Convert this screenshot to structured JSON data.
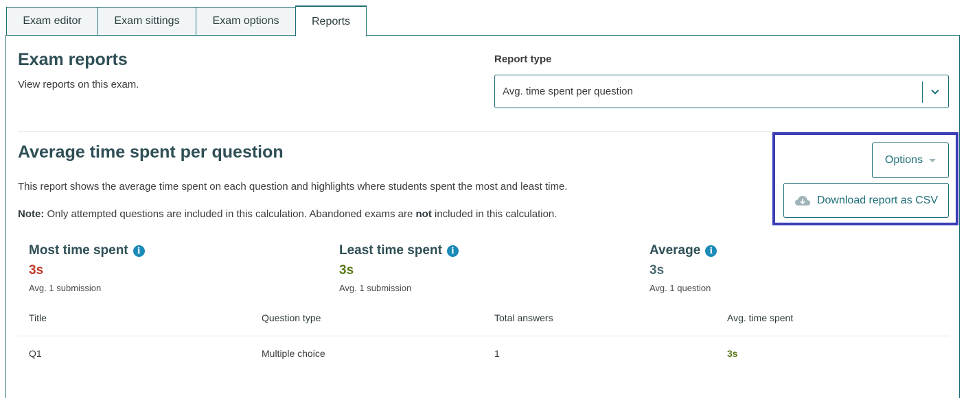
{
  "tabs": [
    {
      "label": "Exam editor"
    },
    {
      "label": "Exam sittings"
    },
    {
      "label": "Exam options"
    },
    {
      "label": "Reports"
    }
  ],
  "header": {
    "title": "Exam reports",
    "subtitle": "View reports on this exam."
  },
  "report_type": {
    "label": "Report type",
    "selected": "Avg. time spent per question"
  },
  "report": {
    "title": "Average time spent per question",
    "description": "This report shows the average time spent on each question and highlights where students spent the most and least time.",
    "note_label": "Note:",
    "note_part1": " Only attempted questions are included in this calculation. Abandoned exams are ",
    "note_bold": "not",
    "note_part2": " included in this calculation."
  },
  "actions": {
    "options_label": "Options",
    "download_label": "Download report as CSV"
  },
  "stats": {
    "most": {
      "title": "Most time spent",
      "value": "3s",
      "sub": "Avg. 1 submission",
      "color": "#c0392b"
    },
    "least": {
      "title": "Least time spent",
      "value": "3s",
      "sub": "Avg. 1 submission",
      "color": "#5a7a1a"
    },
    "average": {
      "title": "Average",
      "value": "3s",
      "sub": "Avg. 1 question",
      "color": "#4a6b72"
    }
  },
  "table": {
    "columns": [
      "Title",
      "Question type",
      "Total answers",
      "Avg. time spent"
    ],
    "rows": [
      {
        "title": "Q1",
        "type": "Multiple choice",
        "answers": "1",
        "avg": "3s"
      }
    ]
  },
  "colors": {
    "accent": "#1f6f78",
    "highlight_border": "#3b3db6",
    "info_icon": "#1a8ab8"
  }
}
